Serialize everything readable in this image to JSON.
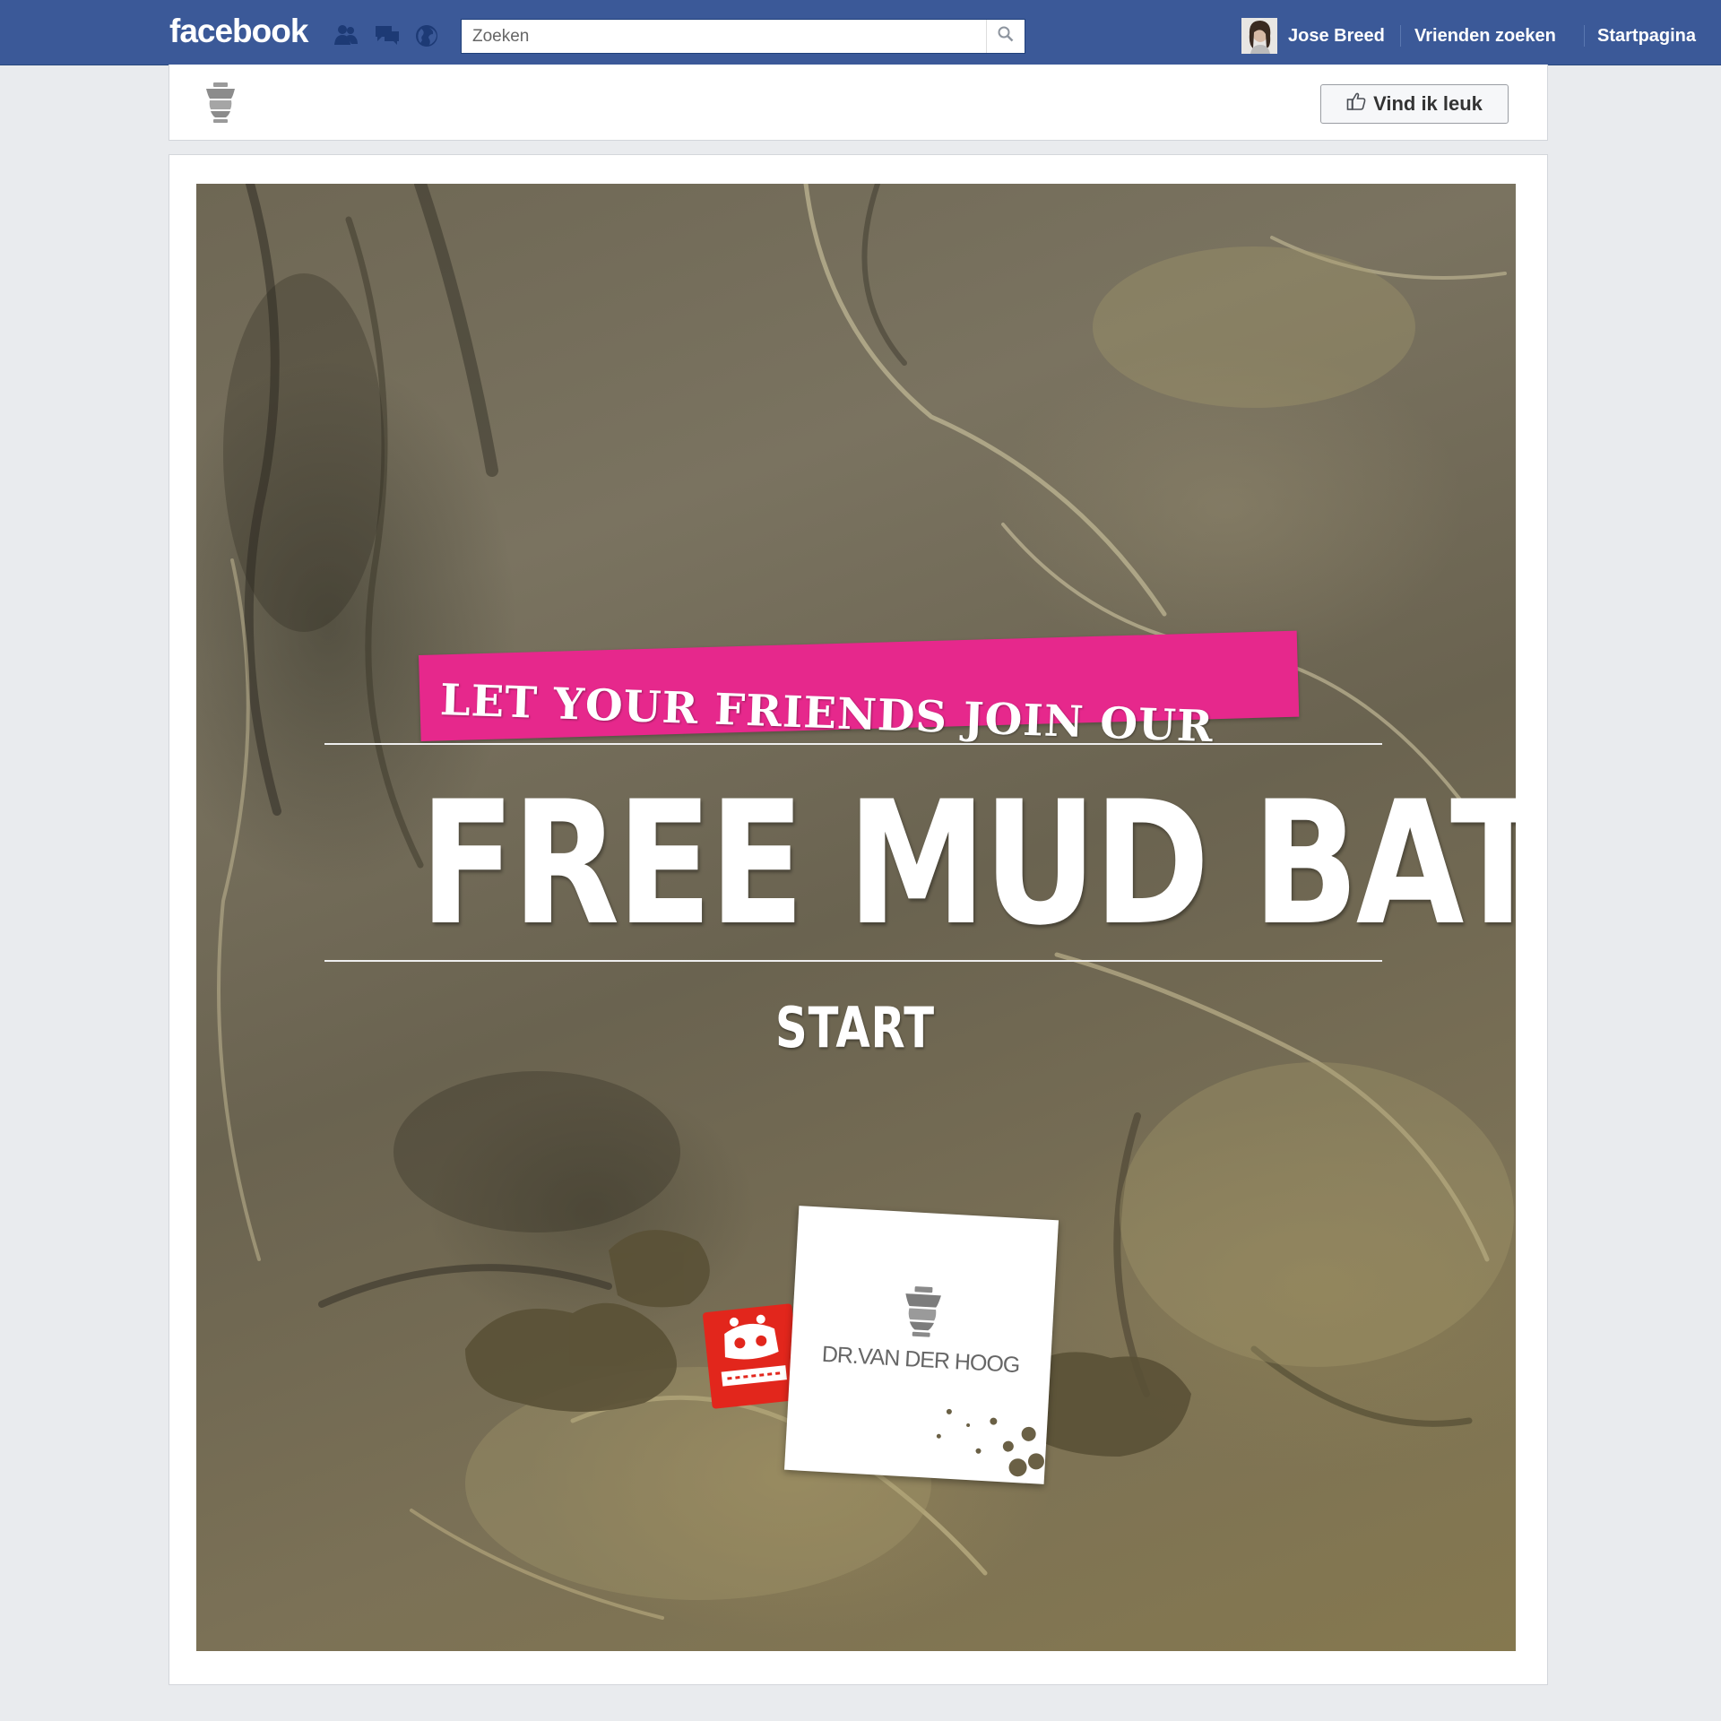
{
  "topbar": {
    "logo": "facebook",
    "search": {
      "placeholder": "Zoeken",
      "value": ""
    },
    "user_name": "Jose Breed",
    "nav": [
      "Vrienden zoeken",
      "Startpagina"
    ]
  },
  "page_header": {
    "like_label": "Vind ik leuk"
  },
  "app": {
    "banner_text": "LET YOUR FRIENDS JOIN OUR",
    "headline": "FREE MUD BATHS",
    "start_label": "START",
    "brand_logo_text": "DR.VAN DER HOOG"
  },
  "colors": {
    "fb_blue": "#3b5998",
    "page_bg": "#e9ebee",
    "banner_pink": "#e6288c",
    "badge_red": "#e2261c",
    "mud": "#736b55"
  },
  "icons": [
    "friend-requests-icon",
    "messages-icon",
    "notifications-globe-icon",
    "search-icon",
    "urn-logo-icon",
    "thumbs-up-icon",
    "robot-badge-icon"
  ]
}
